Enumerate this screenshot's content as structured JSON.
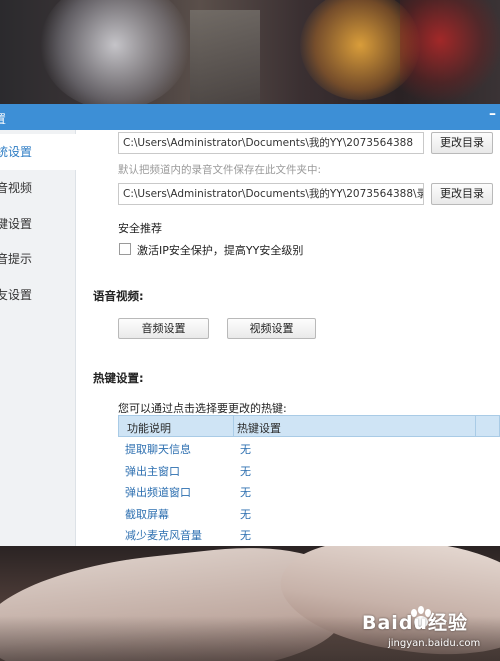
{
  "window": {
    "title": "置",
    "min_glyph": "–"
  },
  "sidebar": {
    "items": [
      {
        "label": "统设置",
        "active": true
      },
      {
        "label": "音视频",
        "active": false
      },
      {
        "label": "键设置",
        "active": false
      },
      {
        "label": "音提示",
        "active": false
      },
      {
        "label": "友设置",
        "active": false
      }
    ]
  },
  "storage": {
    "path1": "C:\\Users\\Administrator\\Documents\\我的YY\\2073564388",
    "path2": "C:\\Users\\Administrator\\Documents\\我的YY\\2073564388\\录",
    "hint": "默认把频道内的录音文件保存在此文件夹中:",
    "change_dir_label": "更改目录"
  },
  "security": {
    "heading": "安全推荐",
    "checkbox_label": "激活IP安全保护，提高YY安全级别",
    "checked": false
  },
  "av": {
    "heading": "语音视频:",
    "audio_button": "音频设置",
    "video_button": "视频设置"
  },
  "hotkeys": {
    "heading": "热键设置:",
    "instruction": "您可以通过点击选择要更改的热键:",
    "columns": [
      "功能说明",
      "热键设置"
    ],
    "rows": [
      {
        "func": "提取聊天信息",
        "key": "无"
      },
      {
        "func": "弹出主窗口",
        "key": "无"
      },
      {
        "func": "弹出频道窗口",
        "key": "无"
      },
      {
        "func": "截取屏幕",
        "key": "无"
      },
      {
        "func": "减少麦克风音量",
        "key": "无"
      }
    ]
  },
  "watermark": {
    "logo_text": "Baidu经验",
    "url": "jingyan.baidu.com"
  },
  "colors": {
    "titlebar": "#3d8fd6",
    "active_nav": "#2d7cc4",
    "table_header": "#cfe4f5",
    "table_text": "#2d6fb0"
  }
}
